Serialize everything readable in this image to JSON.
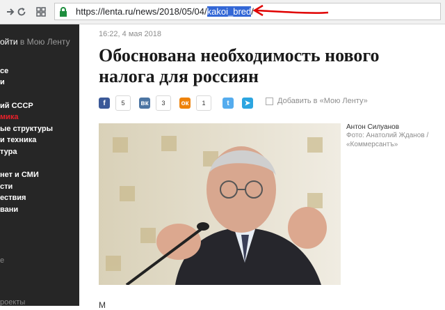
{
  "browser": {
    "url_prefix": "https://lenta.ru/news/2018/05/04/",
    "url_selected": "kakoi_bred",
    "url_suffix": "/"
  },
  "sidebar": {
    "login_label": "ойти",
    "login_suffix": " в Мою Ленту",
    "items": [
      {
        "label": "се",
        "state": "normal"
      },
      {
        "label": "и",
        "state": "normal"
      },
      {
        "label": "ий СССР",
        "state": "normal"
      },
      {
        "label": "мика",
        "state": "active"
      },
      {
        "label": "ые структуры",
        "state": "normal"
      },
      {
        "label": "и техника",
        "state": "normal"
      },
      {
        "label": "тура",
        "state": "normal"
      },
      {
        "label": "нет и СМИ",
        "state": "normal"
      },
      {
        "label": "сти",
        "state": "normal"
      },
      {
        "label": "ествия",
        "state": "normal"
      },
      {
        "label": "вани",
        "state": "normal"
      },
      {
        "label": "е",
        "state": "dim"
      },
      {
        "label": "роекты",
        "state": "dim"
      }
    ]
  },
  "article": {
    "date": "16:22, 4 мая 2018",
    "title": "Обоснована необходимость нового налога для россиян",
    "share": [
      {
        "network": "facebook",
        "glyph": "f",
        "color": "#3b5998",
        "count": "5"
      },
      {
        "network": "vkontakte",
        "glyph": "вк",
        "color": "#4c75a3",
        "count": "3"
      },
      {
        "network": "odnoklassniki",
        "glyph": "ок",
        "color": "#ee8208",
        "count": "1"
      },
      {
        "network": "twitter",
        "glyph": "t",
        "color": "#55acee",
        "count": ""
      },
      {
        "network": "telegram",
        "glyph": "➤",
        "color": "#2ca5e0",
        "count": ""
      }
    ],
    "add_to_lenta": "Добавить в «Мою Ленту»",
    "caption_name": "Антон Силуанов",
    "caption_credit": "Фото: Анатолий Жданов / «Коммерсантъ»",
    "body_snippet": "М"
  },
  "colors": {
    "accent": "#e8212b",
    "sidebar_bg": "#262626",
    "selection": "#3367d6",
    "annotation_arrow": "#e00000"
  }
}
